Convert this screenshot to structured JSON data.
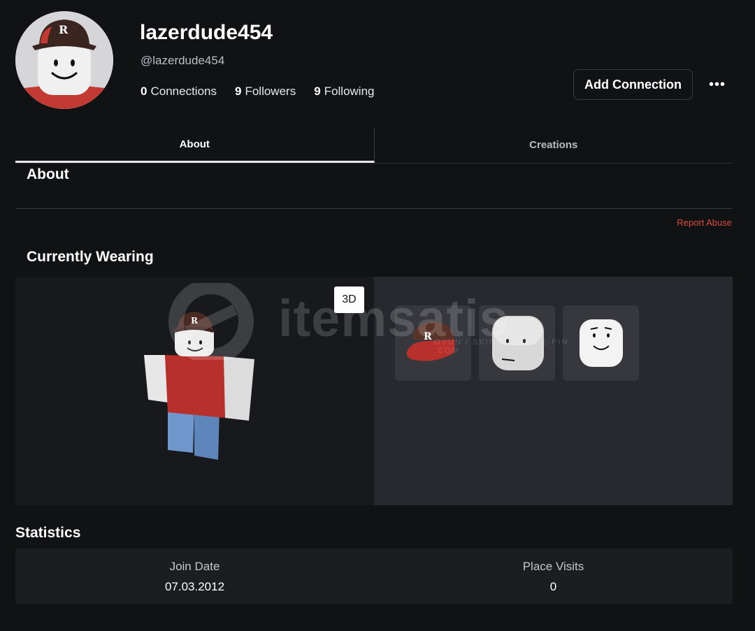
{
  "profile": {
    "display_name": "lazerdude454",
    "handle": "@lazerdude454",
    "connections_count": "0",
    "connections_label": "Connections",
    "followers_count": "9",
    "followers_label": "Followers",
    "following_count": "9",
    "following_label": "Following",
    "add_connection_label": "Add Connection",
    "more_label": "•••"
  },
  "tabs": [
    {
      "label": "About",
      "active": true
    },
    {
      "label": "Creations",
      "active": false
    }
  ],
  "about": {
    "title": "About",
    "report_abuse": "Report Abuse"
  },
  "wearing": {
    "title": "Currently Wearing",
    "toggle_3d": "3D",
    "items": [
      {
        "name": "cap-item-icon"
      },
      {
        "name": "head-item-icon"
      },
      {
        "name": "face-item-icon"
      }
    ]
  },
  "watermark": {
    "text": "itemsatis",
    "sub": "OYUN / SKIN / ITEM / E-PIN .COM"
  },
  "statistics": {
    "title": "Statistics",
    "join_date_label": "Join Date",
    "join_date": "07.03.2012",
    "place_visits_label": "Place Visits",
    "place_visits": "0"
  },
  "colors": {
    "background": "#111214",
    "report_abuse": "#d94b3c",
    "avatar_shirt": "#b8302b",
    "avatar_pants": "#6b93c9"
  }
}
